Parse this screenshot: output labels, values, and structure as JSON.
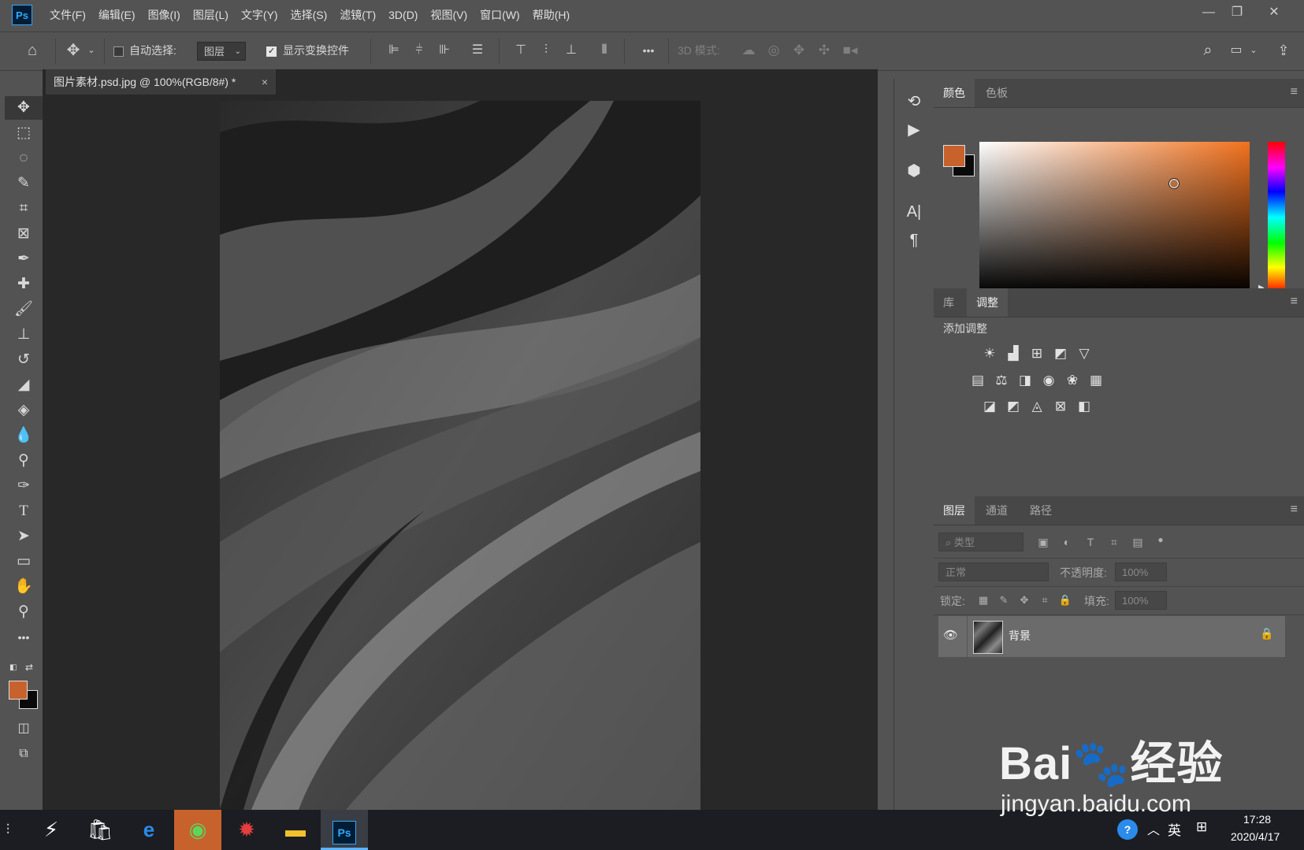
{
  "menubar": {
    "logo": "Ps",
    "items": [
      "文件(F)",
      "编辑(E)",
      "图像(I)",
      "图层(L)",
      "文字(Y)",
      "选择(S)",
      "滤镜(T)",
      "3D(D)",
      "视图(V)",
      "窗口(W)",
      "帮助(H)"
    ]
  },
  "options": {
    "auto_select_label": "自动选择:",
    "auto_select_checked": false,
    "target_value": "图层",
    "show_transform_label": "显示变换控件",
    "show_transform_checked": true,
    "more": "•••",
    "mode3d_label": "3D 模式:"
  },
  "document": {
    "tab_title": "图片素材.psd.jpg @ 100%(RGB/8#) *",
    "close": "×"
  },
  "colors": {
    "foreground": "#c8622d",
    "background": "#0a0a0a",
    "picker_hue": "#f2721e"
  },
  "color_panel": {
    "tabs": [
      "颜色",
      "色板"
    ],
    "active_tab": "颜色"
  },
  "adjust_panel": {
    "tabs": [
      "库",
      "调整"
    ],
    "active_tab": "调整",
    "title": "添加调整",
    "icons_row1": [
      "brightness-icon",
      "levels-icon",
      "curves-icon",
      "exposure-icon",
      "vibrance-icon"
    ],
    "icons_row2": [
      "hue-saturation-icon",
      "color-balance-icon",
      "black-white-icon",
      "photo-filter-icon",
      "channel-mixer-icon",
      "color-lookup-icon"
    ],
    "icons_row3": [
      "invert-icon",
      "posterize-icon",
      "threshold-icon",
      "selective-color-icon",
      "gradient-map-icon"
    ]
  },
  "layers_panel": {
    "tabs": [
      "图层",
      "通道",
      "路径"
    ],
    "active_tab": "图层",
    "filter_placeholder": "类型",
    "blend_mode": "正常",
    "opacity_label": "不透明度:",
    "opacity_value": "100%",
    "lock_label": "锁定:",
    "fill_label": "填充:",
    "fill_value": "100%",
    "layers": [
      {
        "name": "背景",
        "visible": true,
        "locked": true
      }
    ]
  },
  "taskbar": {
    "time": "17:28",
    "date": "2020/4/17",
    "ime": "英"
  },
  "watermark": {
    "logo": "Bai🐾经验",
    "url": "jingyan.baidu.com"
  }
}
